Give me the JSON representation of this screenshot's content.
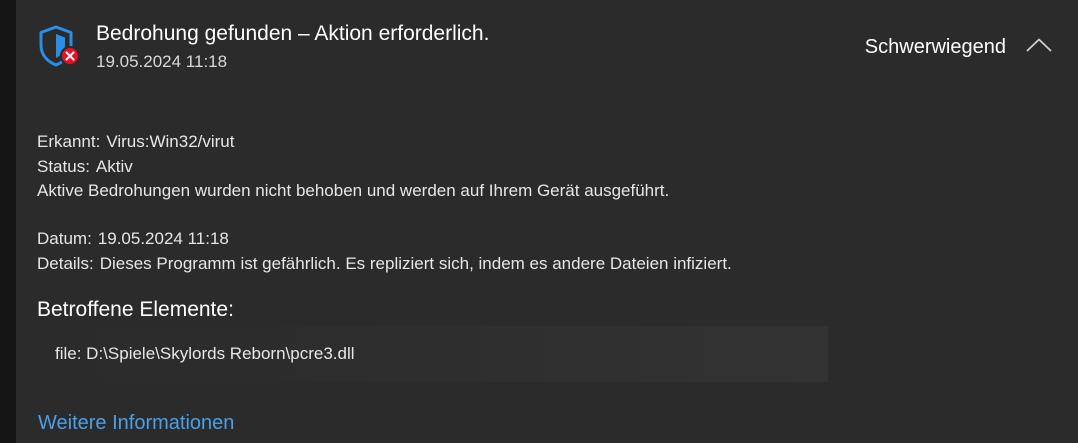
{
  "header": {
    "title": "Bedrohung gefunden – Aktion erforderlich.",
    "timestamp": "19.05.2024 11:18",
    "severity": "Schwerwiegend",
    "icon": "shield-threat-icon",
    "collapse_icon": "chevron-up-icon"
  },
  "details": {
    "detected_label": "Erkannt:",
    "detected_value": "Virus:Win32/virut",
    "status_label": "Status:",
    "status_value": "Aktiv",
    "status_message": "Aktive Bedrohungen wurden nicht behoben und werden auf Ihrem Gerät ausgeführt.",
    "date_label": "Datum:",
    "date_value": "19.05.2024 11:18",
    "details_label": "Details:",
    "details_value": "Dieses Programm ist gefährlich. Es repliziert sich, indem es andere Dateien infiziert."
  },
  "affected": {
    "heading": "Betroffene Elemente:",
    "items": [
      "file: D:\\Spiele\\Skylords Reborn\\pcre3.dll"
    ]
  },
  "footer": {
    "more_info_link": "Weitere Informationen"
  },
  "colors": {
    "card_background": "#2b2b2b",
    "shield_blue": "#2a8ee6",
    "threat_red": "#e81123",
    "link_blue": "#4a9fe8"
  }
}
